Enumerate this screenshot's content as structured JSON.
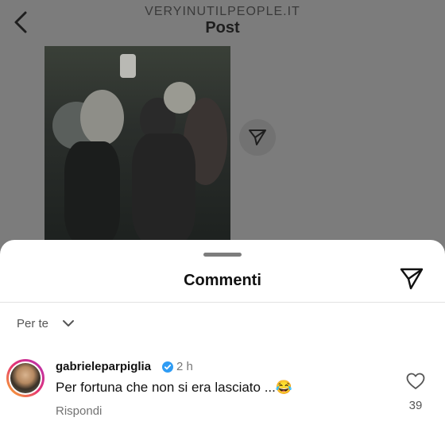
{
  "header": {
    "site": "VERYINUTILPEOPLE.IT",
    "title": "Post"
  },
  "sheet": {
    "title": "Commenti",
    "filter_label": "Per te"
  },
  "comment": {
    "username": "gabrieleparpiglia",
    "verified": true,
    "time": "2 h",
    "text": "Per fortuna che non si era lasciato ...😂",
    "reply_label": "Rispondi",
    "likes": "39"
  }
}
